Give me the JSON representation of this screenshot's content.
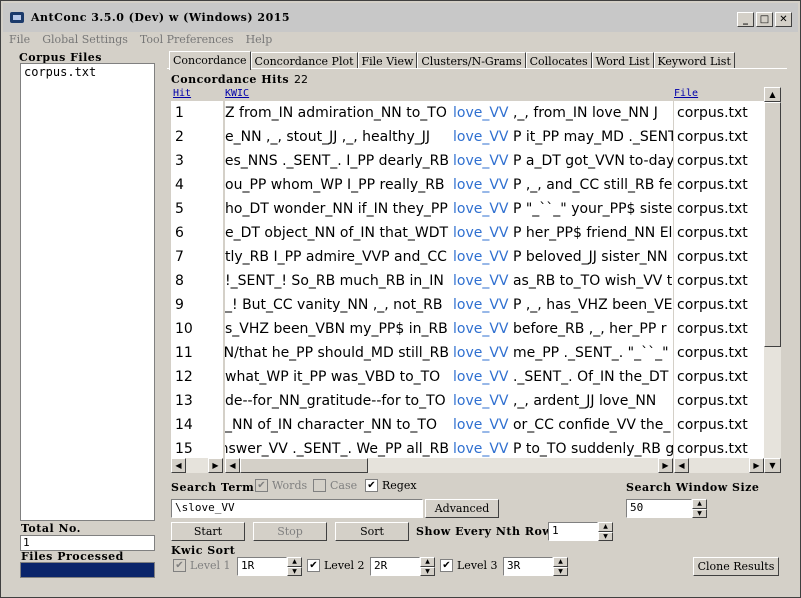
{
  "window": {
    "title": "AntConc 3.5.0 (Dev) w (Windows) 2015"
  },
  "menu": [
    "File",
    "Global Settings",
    "Tool Preferences",
    "Help"
  ],
  "left": {
    "corpus_files_label": "Corpus Files",
    "files": [
      "corpus.txt"
    ],
    "total_no_label": "Total No.",
    "total_no": "1",
    "files_processed_label": "Files Processed",
    "progress": 1.0
  },
  "tabs": [
    "Concordance",
    "Concordance Plot",
    "File View",
    "Clusters/N-Grams",
    "Collocates",
    "Word List",
    "Keyword List"
  ],
  "concordance": {
    "hits_label": "Concordance Hits",
    "hits": "22",
    "col_hit": "Hit",
    "col_kwic": "KWIC",
    "col_file": "File",
    "rows": [
      {
        "hit": "1",
        "left": "Z from_IN admiration_NN to_TO",
        "kw": "love_VV",
        "right": ",_, from_IN love_NN J",
        "file": "corpus.txt"
      },
      {
        "hit": "2",
        "left": "e_NN ,_, stout_JJ ,_, healthy_JJ",
        "kw": "love_VV",
        "right": "P it_PP may_MD ._SENT",
        "file": "corpus.txt"
      },
      {
        "hit": "3",
        "left": "es_NNS ._SENT_. I_PP dearly_RB",
        "kw": "love_VV",
        "right": "P a_DT got_VVN to-day",
        "file": "corpus.txt"
      },
      {
        "hit": "4",
        "left": "ou_PP whom_WP I_PP really_RB",
        "kw": "love_VV",
        "right": "P ,_, and_CC still_RB fe",
        "file": "corpus.txt"
      },
      {
        "hit": "5",
        "left": "ho_DT wonder_NN if_IN they_PP",
        "kw": "love_VV",
        "right": "P \"_``_\" your_PP$ sister",
        "file": "corpus.txt"
      },
      {
        "hit": "6",
        "left": "e_DT object_NN of_IN that_WDT",
        "kw": "love_VV",
        "right": "P her_PP$ friend_NN El",
        "file": "corpus.txt"
      },
      {
        "hit": "7",
        "left": "tly_RB I_PP admire_VVP and_CC",
        "kw": "love_VV",
        "right": "P beloved_JJ sister_NN",
        "file": "corpus.txt"
      },
      {
        "hit": "8",
        "left": "!_SENT_! So_RB much_RB in_IN",
        "kw": "love_VV",
        "right": "as_RB to_TO wish_VV t",
        "file": "corpus.txt"
      },
      {
        "hit": "9",
        "left": "_! But_CC vanity_NN ,_, not_RB",
        "kw": "love_VV",
        "right": "P ,_, has_VHZ been_VE",
        "file": "corpus.txt"
      },
      {
        "hit": "10",
        "left": "s_VHZ been_VBN my_PP$ in_RB",
        "kw": "love_VV",
        "right": "before_RB ,_, her_PP r",
        "file": "corpus.txt"
      },
      {
        "hit": "11",
        "left": "N/that he_PP should_MD still_RB",
        "kw": "love_VV",
        "right": "me_PP ._SENT_. \"_``_\" w",
        "file": "corpus.txt"
      },
      {
        "hit": "12",
        "left": "what_WP it_PP was_VBD to_TO",
        "kw": "love_VV",
        "right": "._SENT_. Of_IN the_DT",
        "file": "corpus.txt"
      },
      {
        "hit": "13",
        "left": "de--for_NN_gratitude--for to_TO",
        "kw": "love_VV",
        "right": ",_, ardent_JJ love_NN",
        "file": "corpus.txt"
      },
      {
        "hit": "14",
        "left": "_NN of_IN character_NN to_TO",
        "kw": "love_VV",
        "right": "or_CC confide_VV the_",
        "file": "corpus.txt"
      },
      {
        "hit": "15",
        "left": "nswer_VV ._SENT_. We_PP all_RB",
        "kw": "love_VV",
        "right": "P to_TO suddenly_RB g",
        "file": "corpus.txt"
      }
    ]
  },
  "search": {
    "label": "Search Term",
    "words_label": "Words",
    "case_label": "Case",
    "regex_label": "Regex",
    "words_checked": true,
    "case_checked": false,
    "regex_checked": true,
    "term": "\\slove_VV",
    "advanced_label": "Advanced",
    "start_label": "Start",
    "stop_label": "Stop",
    "sort_label": "Sort",
    "show_every_label": "Show Every Nth Row",
    "show_every_value": "1",
    "window_size_label": "Search Window Size",
    "window_size_value": "50"
  },
  "kwic_sort": {
    "label": "Kwic Sort",
    "level1_label": "Level 1",
    "level1_value": "1R",
    "level2_label": "Level 2",
    "level2_value": "2R",
    "level3_label": "Level 3",
    "level3_value": "3R",
    "clone_label": "Clone Results"
  }
}
